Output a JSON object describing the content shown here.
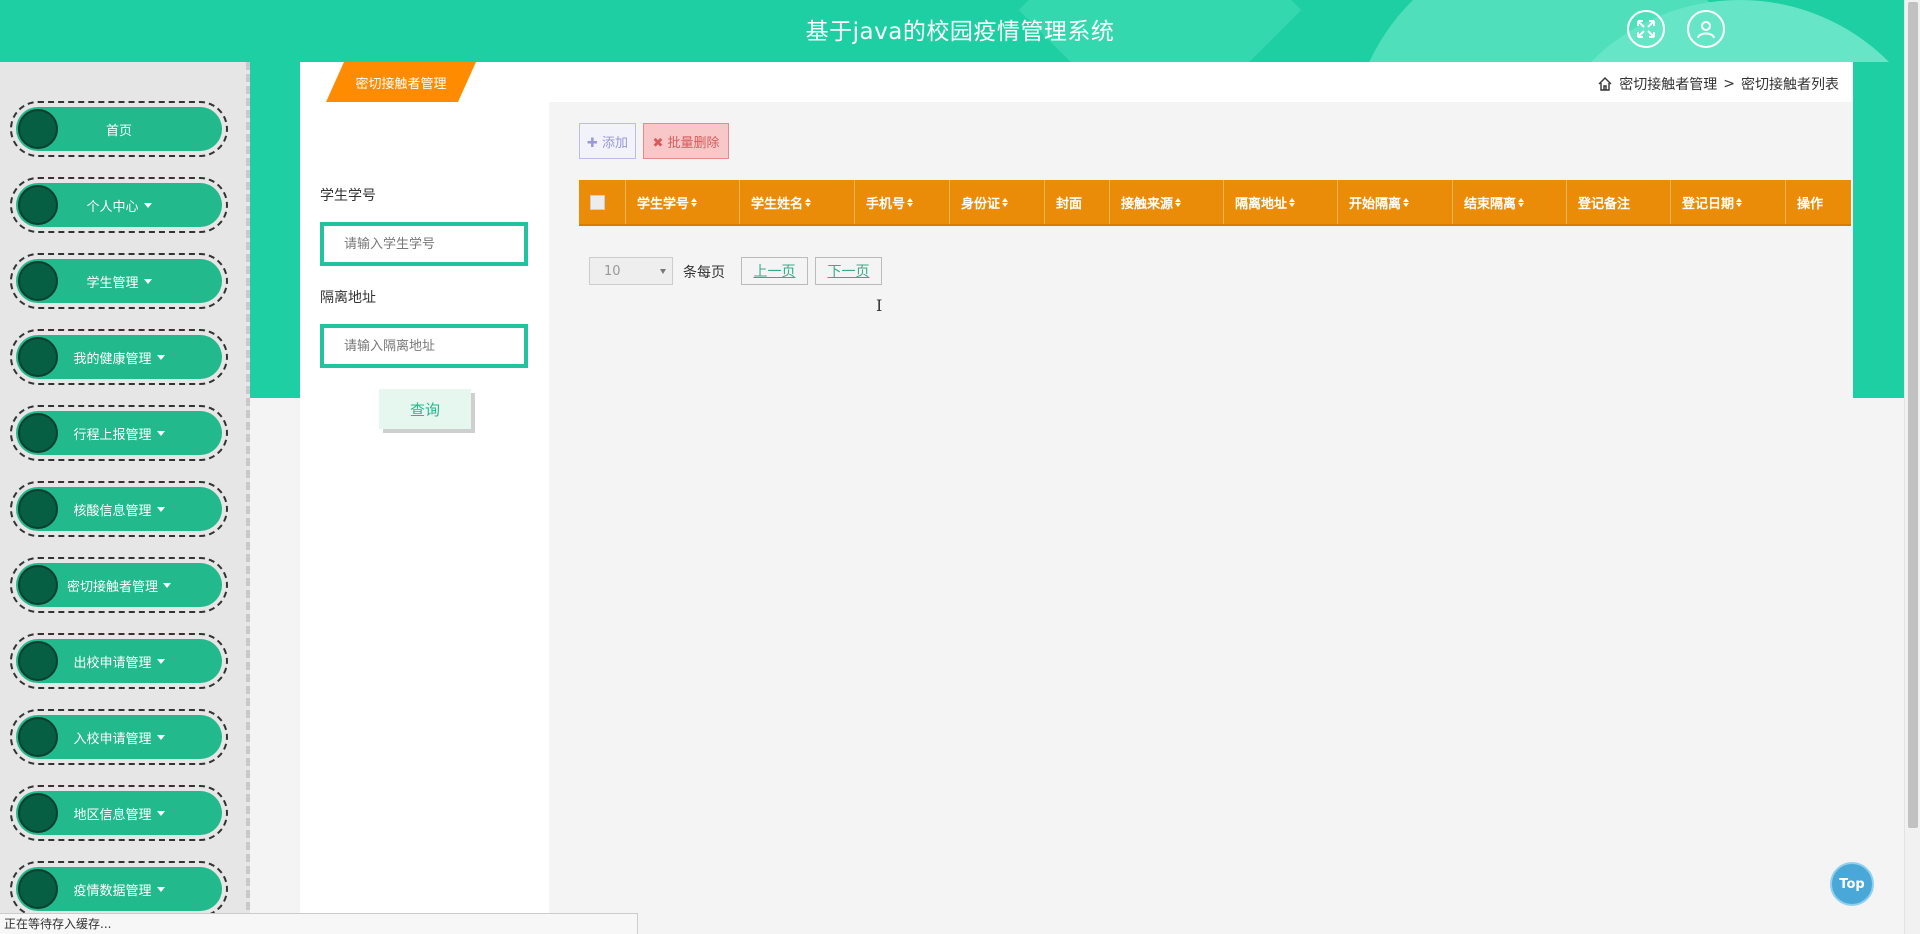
{
  "header": {
    "title": "基于java的校园疫情管理系统",
    "fullscreen_icon": "expand-icon",
    "user_icon": "user-icon"
  },
  "sidebar": {
    "items": [
      {
        "label": "首页",
        "has_caret": false
      },
      {
        "label": "个人中心",
        "has_caret": true
      },
      {
        "label": "学生管理",
        "has_caret": true
      },
      {
        "label": "我的健康管理",
        "has_caret": true
      },
      {
        "label": "行程上报管理",
        "has_caret": true
      },
      {
        "label": "核酸信息管理",
        "has_caret": true
      },
      {
        "label": "密切接触者管理",
        "has_caret": true
      },
      {
        "label": "出校申请管理",
        "has_caret": true
      },
      {
        "label": "入校申请管理",
        "has_caret": true
      },
      {
        "label": "地区信息管理",
        "has_caret": true
      },
      {
        "label": "疫情数据管理",
        "has_caret": true
      }
    ]
  },
  "panel": {
    "tab_label": "密切接触者管理",
    "breadcrumb": {
      "home_icon": "home-icon",
      "level1": "密切接触者管理",
      "separator": ">",
      "level2": "密切接触者列表"
    }
  },
  "search": {
    "student_no_label": "学生学号",
    "student_no_placeholder": "请输入学生学号",
    "address_label": "隔离地址",
    "address_placeholder": "请输入隔离地址",
    "query_label": "查询"
  },
  "toolbar": {
    "add_label": "添加",
    "batch_delete_label": "批量删除"
  },
  "table": {
    "columns": [
      {
        "label": "学生学号",
        "sortable": true
      },
      {
        "label": "学生姓名",
        "sortable": true
      },
      {
        "label": "手机号",
        "sortable": true
      },
      {
        "label": "身份证",
        "sortable": true
      },
      {
        "label": "封面",
        "sortable": false
      },
      {
        "label": "接触来源",
        "sortable": true
      },
      {
        "label": "隔离地址",
        "sortable": true
      },
      {
        "label": "开始隔离",
        "sortable": true
      },
      {
        "label": "结束隔离",
        "sortable": true
      },
      {
        "label": "登记备注",
        "sortable": false
      },
      {
        "label": "登记日期",
        "sortable": true
      },
      {
        "label": "操作",
        "sortable": false
      }
    ],
    "rows": []
  },
  "pager": {
    "page_size": "10",
    "per_page_label": "条每页",
    "prev_label": "上一页",
    "next_label": "下一页"
  },
  "top_button_label": "Top",
  "status_bar_text": "正在等待存入缓存...",
  "colors": {
    "header": "#1ecfa3",
    "nav_pill": "#22b98c",
    "nav_dot": "#065e43",
    "table_head": "#ea8c07",
    "tab": "#ff8c00"
  }
}
